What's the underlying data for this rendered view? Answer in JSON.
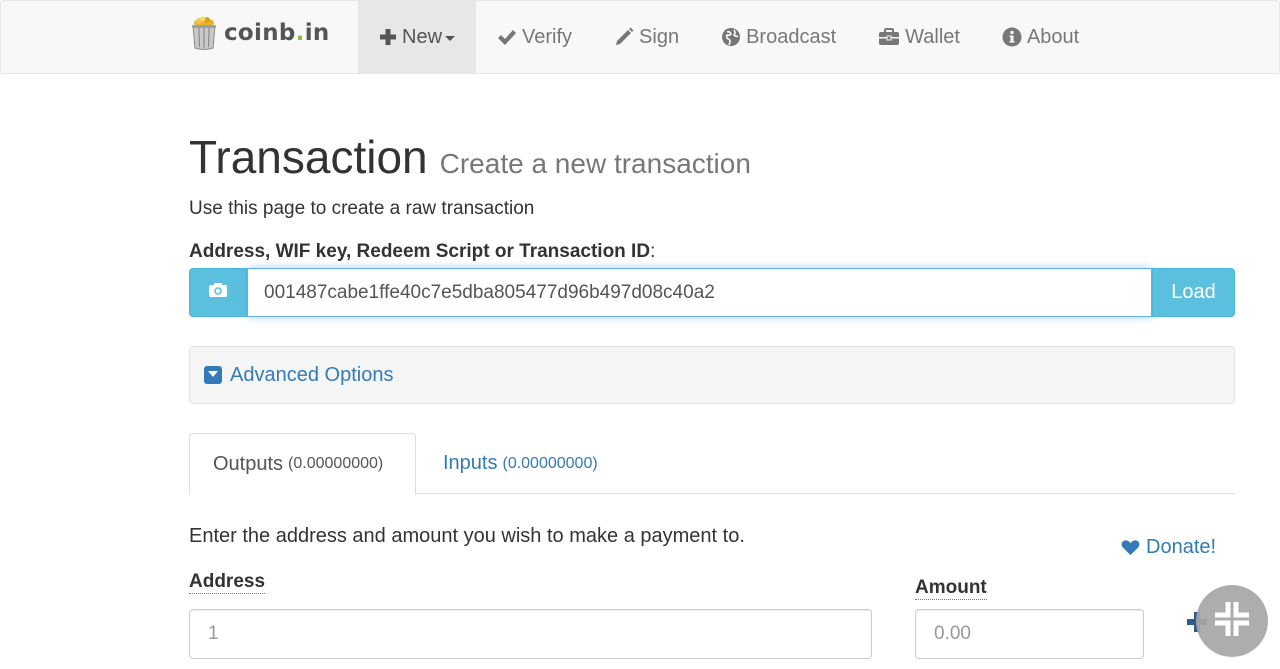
{
  "brand": {
    "name_main": "coinb",
    "name_dot": ".",
    "name_tld": "in",
    "logo_icon": "trash-can-coins-icon"
  },
  "nav": {
    "items": [
      {
        "label": "New",
        "icon": "plus-icon"
      },
      {
        "label": "Verify",
        "icon": "check-icon"
      },
      {
        "label": "Sign",
        "icon": "pencil-icon"
      },
      {
        "label": "Broadcast",
        "icon": "globe-icon"
      },
      {
        "label": "Wallet",
        "icon": "briefcase-icon"
      },
      {
        "label": "About",
        "icon": "info-icon"
      }
    ]
  },
  "header": {
    "title": "Transaction",
    "subtitle": "Create a new transaction"
  },
  "lead": "Use this page to create a raw transaction",
  "load_field": {
    "label": "Address, WIF key, Redeem Script or Transaction ID",
    "label_suffix": ":",
    "value": "001487cabe1ffe40c7e5dba805477d96b497d08c40a2",
    "button": "Load",
    "camera_icon": "camera-icon"
  },
  "advanced": {
    "label": "Advanced Options",
    "icon": "caret-square-down-icon"
  },
  "tabs": [
    {
      "label": "Outputs",
      "amount": "(0.00000000)",
      "active": true
    },
    {
      "label": "Inputs",
      "amount": "(0.00000000)",
      "active": false
    }
  ],
  "outputs": {
    "instruction": "Enter the address and amount you wish to make a payment to.",
    "donate": "Donate!",
    "address_label": "Address",
    "address_placeholder": "1",
    "amount_label": "Amount",
    "amount_placeholder": "0.00"
  },
  "colors": {
    "info": "#5bc0de",
    "link": "#337ab7",
    "navbar_bg": "#f8f8f8"
  }
}
